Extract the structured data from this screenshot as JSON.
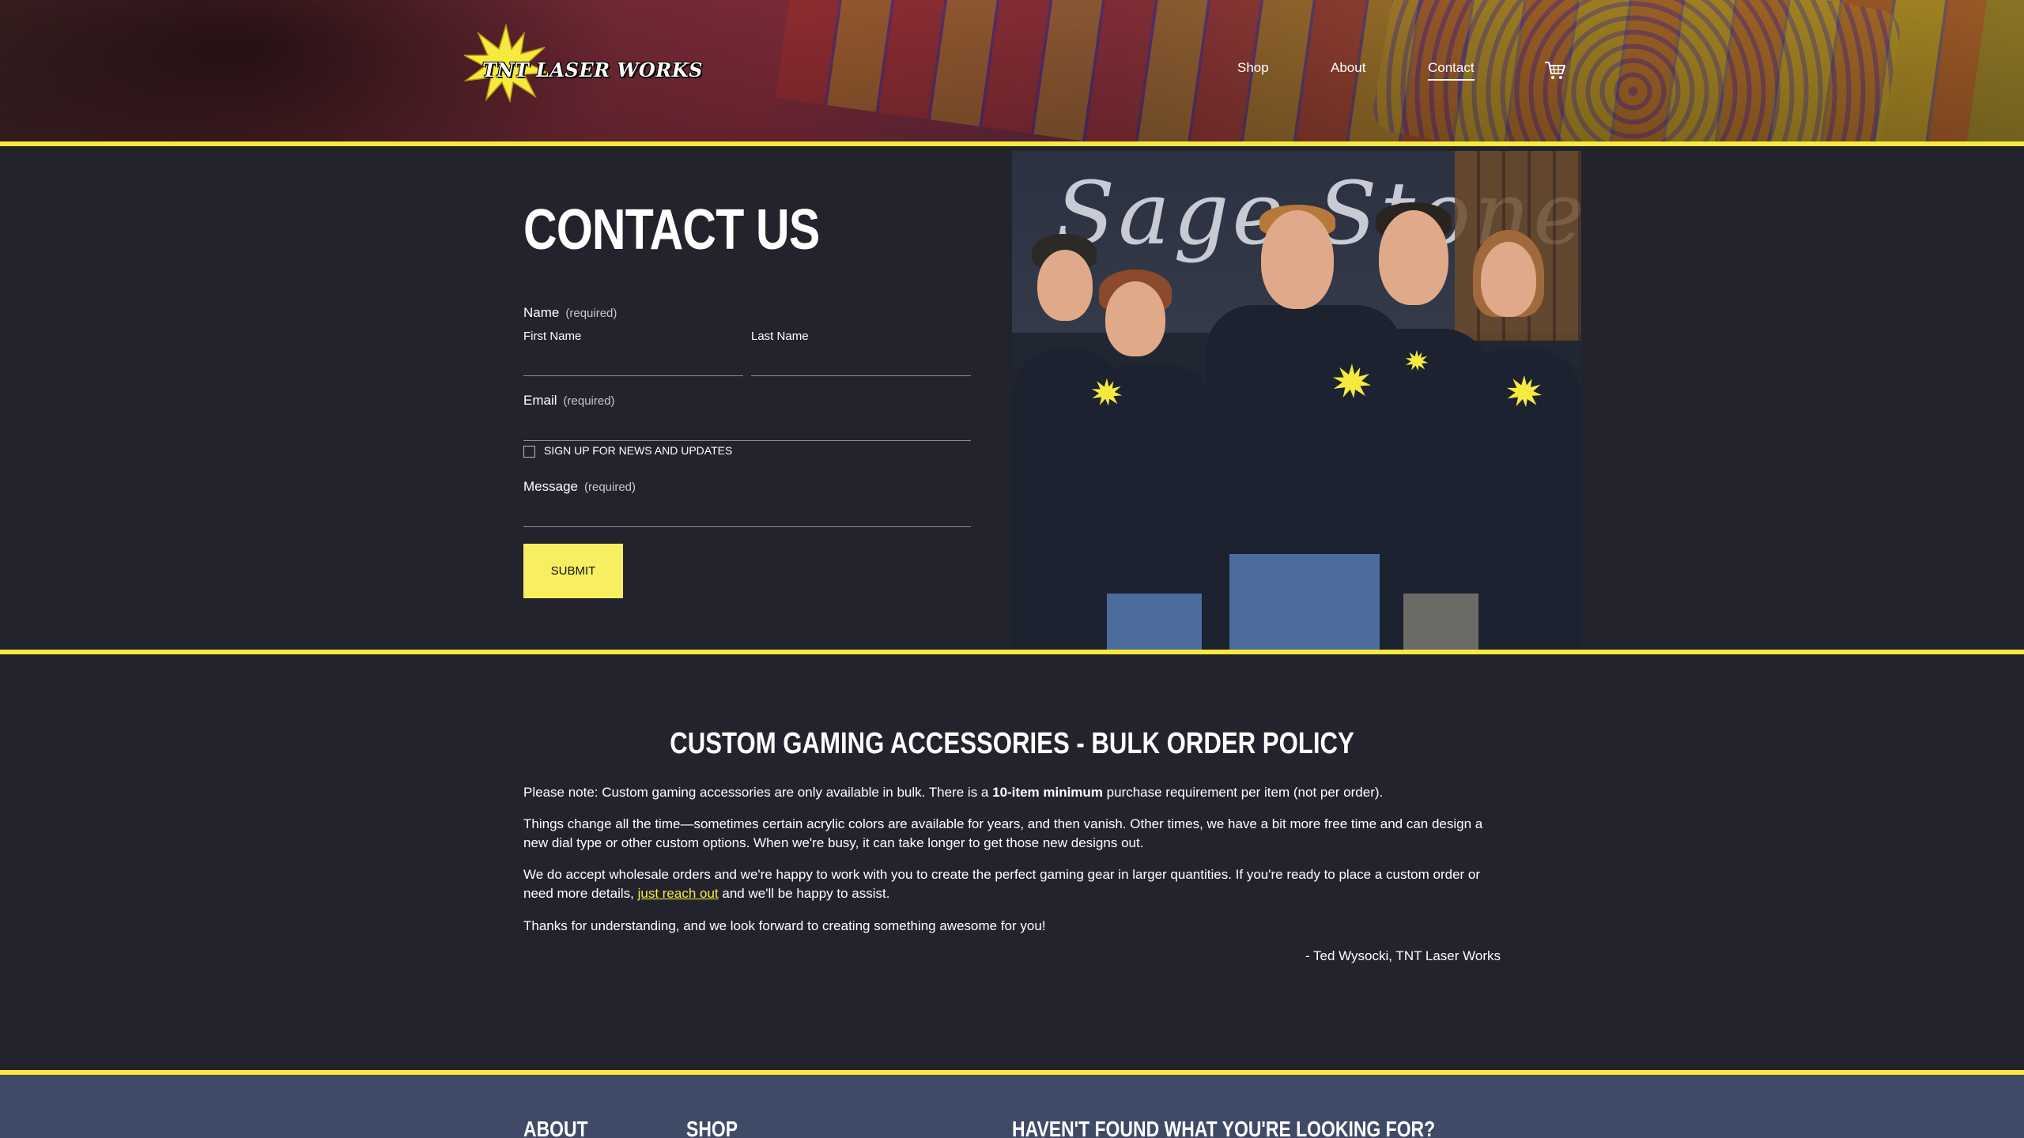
{
  "brand": {
    "logo_text": "TNT LASER WORKS"
  },
  "nav": {
    "items": [
      {
        "label": "Shop"
      },
      {
        "label": "About"
      },
      {
        "label": "Contact",
        "active": true
      }
    ],
    "cart_icon": "cart-icon"
  },
  "contact": {
    "title": "CONTACT US",
    "name_label": "Name",
    "required_text": "(required)",
    "first_name_label": "First Name",
    "last_name_label": "Last Name",
    "email_label": "Email",
    "newsletter_label": "SIGN UP FOR NEWS AND UPDATES",
    "newsletter_checked": false,
    "message_label": "Message",
    "submit_label": "SUBMIT"
  },
  "photo": {
    "banner_text": "Sage Stones"
  },
  "policy": {
    "title": "CUSTOM GAMING ACCESSORIES - BULK ORDER POLICY",
    "p1_before": "Please note: Custom gaming accessories are only available in bulk. There is a ",
    "p1_bold": "10-item minimum",
    "p1_after": " purchase requirement per item (not per order).",
    "p2": "Things change all the time—sometimes certain acrylic colors are available for years, and then vanish. Other times, we have a bit more free time and can design a new dial type or other custom options. When we're busy, it can take longer to get those new designs out.",
    "p3_before": "We do accept wholesale orders and we're happy to work with you to create the perfect gaming gear in larger quantities. If you're ready to place a custom order or need more details, ",
    "p3_link": "just reach out",
    "p3_after": " and we'll be happy to assist.",
    "p4": "Thanks for understanding, and we look forward to creating something awesome for you!",
    "signature": "- Ted Wysocki, TNT Laser Works"
  },
  "footer": {
    "about_heading": "ABOUT",
    "shop_heading": "SHOP",
    "cta_heading": "HAVEN'T FOUND WHAT YOU'RE LOOKING FOR?"
  },
  "colors": {
    "accent_yellow": "#f6ea3e",
    "background": "#23232e",
    "footer_bg": "#3f4a66"
  }
}
